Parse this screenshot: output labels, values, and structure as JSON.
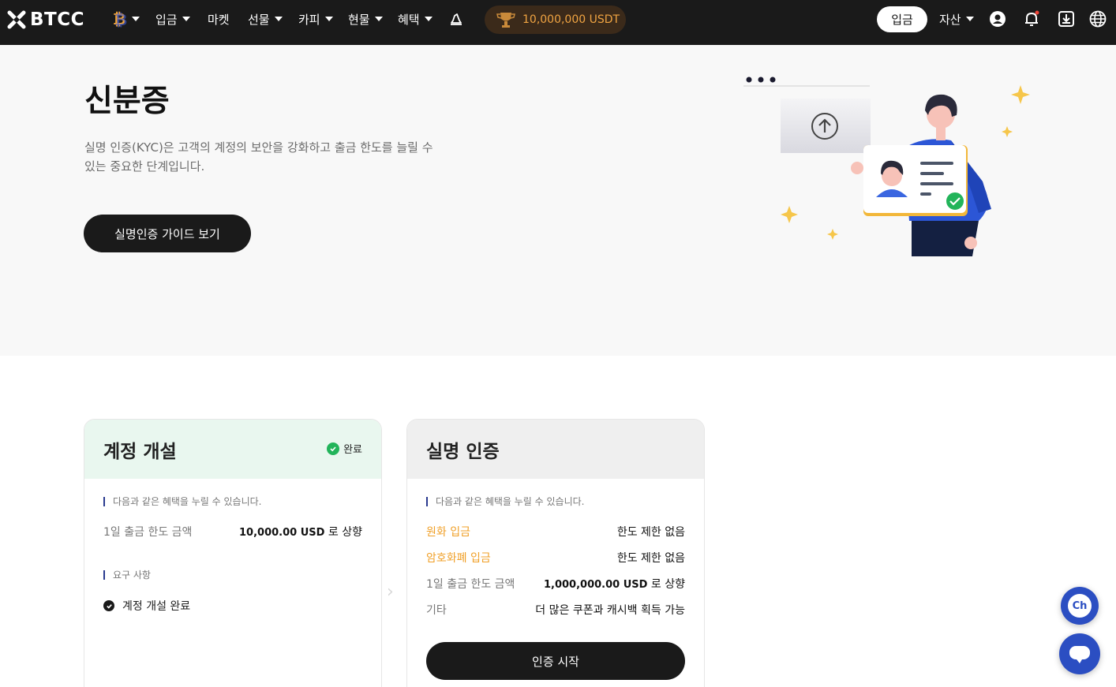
{
  "brand": {
    "name": "BTCC"
  },
  "nav": {
    "items": [
      {
        "label": "입금",
        "has_caret": true
      },
      {
        "label": "마켓",
        "has_caret": false
      },
      {
        "label": "선물",
        "has_caret": true
      },
      {
        "label": "카피",
        "has_caret": true
      },
      {
        "label": "현물",
        "has_caret": true
      },
      {
        "label": "혜택",
        "has_caret": true
      }
    ],
    "promo_label": "10,000,000 USDT",
    "deposit_button": "입금",
    "assets_label": "자산"
  },
  "hero": {
    "title": "신분증",
    "description": "실명 인증(KYC)은 고객의 계정의 보안을 강화하고 출금 한도를 늘릴 수 있는 중요한 단계입니다.",
    "guide_button": "실명인증 가이드 보기"
  },
  "cards": {
    "account": {
      "title": "계정 개설",
      "status": "완료",
      "benefits_label": "다음과 같은 혜택을 누릴 수 있습니다.",
      "limit_key": "1일 출금 한도 금액",
      "limit_amount": "10,000.00 USD",
      "limit_suffix": " 로 상향",
      "requirements_label": "요구 사항",
      "requirement_item": "계정 개설 완료"
    },
    "kyc": {
      "title": "실명 인증",
      "benefits_label": "다음과 같은 혜택을 누릴 수 있습니다.",
      "rows": [
        {
          "key": "원화 입금",
          "value": "한도 제한 없음"
        },
        {
          "key": "암호화폐 입금",
          "value": "한도 제한 없음"
        },
        {
          "key": "1일 출금 한도 금액",
          "amount": "1,000,000.00 USD",
          "suffix": " 로 상향"
        },
        {
          "key": "기타",
          "value": "더 많은 쿠폰과 캐시백 획득 가능"
        }
      ],
      "start_button": "인증 시작"
    }
  },
  "floating": {
    "channel_label": "Ch"
  },
  "colors": {
    "nav_bg": "#1a1a1a",
    "accent_orange": "#f0a028",
    "success_green": "#22b45a",
    "card_done_bg": "#e9f7ef",
    "card_todo_bg": "#efefef"
  }
}
